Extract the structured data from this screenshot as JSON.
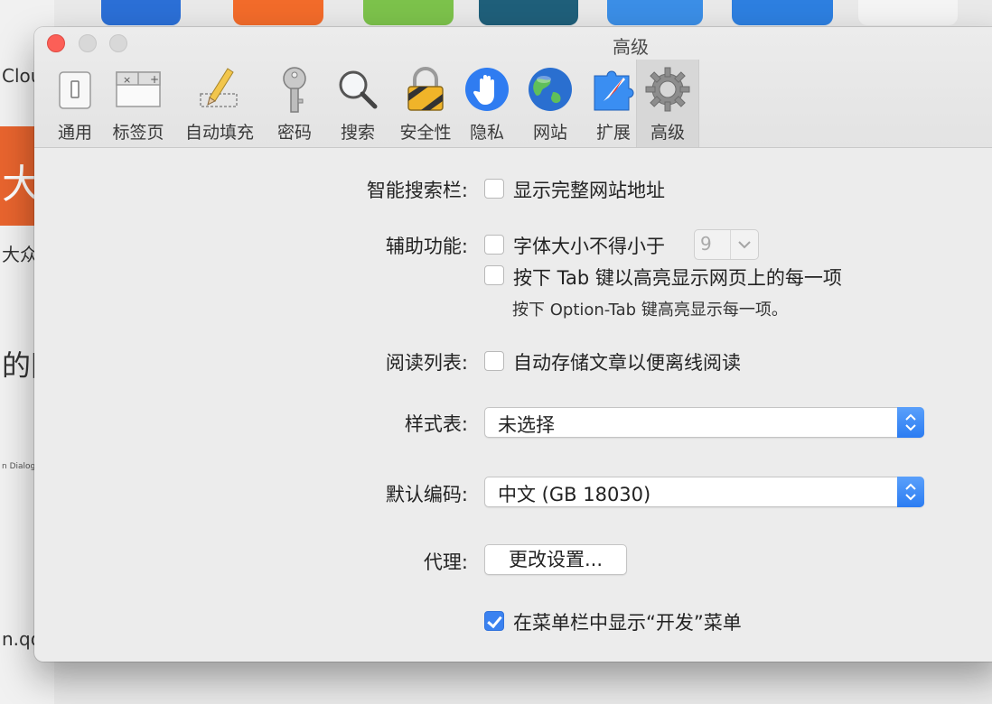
{
  "window": {
    "title": "高级"
  },
  "tabs": [
    {
      "label": "通用"
    },
    {
      "label": "标签页"
    },
    {
      "label": "自动填充"
    },
    {
      "label": "密码"
    },
    {
      "label": "搜索"
    },
    {
      "label": "安全性"
    },
    {
      "label": "隐私"
    },
    {
      "label": "网站"
    },
    {
      "label": "扩展"
    },
    {
      "label": "高级",
      "selected": true
    }
  ],
  "smart_search": {
    "label": "智能搜索栏:",
    "show_full_address": {
      "label": "显示完整网站地址",
      "checked": false
    }
  },
  "accessibility": {
    "label": "辅助功能:",
    "min_font": {
      "label": "字体大小不得小于",
      "checked": false,
      "value": "9"
    },
    "tab_highlight": {
      "label": "按下 Tab 键以高亮显示网页上的每一项",
      "checked": false
    },
    "hint": "按下 Option-Tab 键高亮显示每一项。"
  },
  "reading_list": {
    "label": "阅读列表:",
    "save_offline": {
      "label": "自动存储文章以便离线阅读",
      "checked": false
    }
  },
  "stylesheet": {
    "label": "样式表:",
    "value": "未选择"
  },
  "encoding": {
    "label": "默认编码:",
    "value": "中文 (GB 18030)"
  },
  "proxy": {
    "label": "代理:",
    "button": "更改设置..."
  },
  "develop_menu": {
    "label": "在菜单栏中显示“开发”菜单",
    "checked": true
  },
  "background": {
    "texts": [
      "Clou",
      "大众点",
      "的网",
      "n.qq"
    ],
    "orange_char": "大",
    "snippets": [
      "n Dialog"
    ]
  },
  "colors": {
    "accent": "#3b82f0",
    "close": "#fc5f57"
  }
}
